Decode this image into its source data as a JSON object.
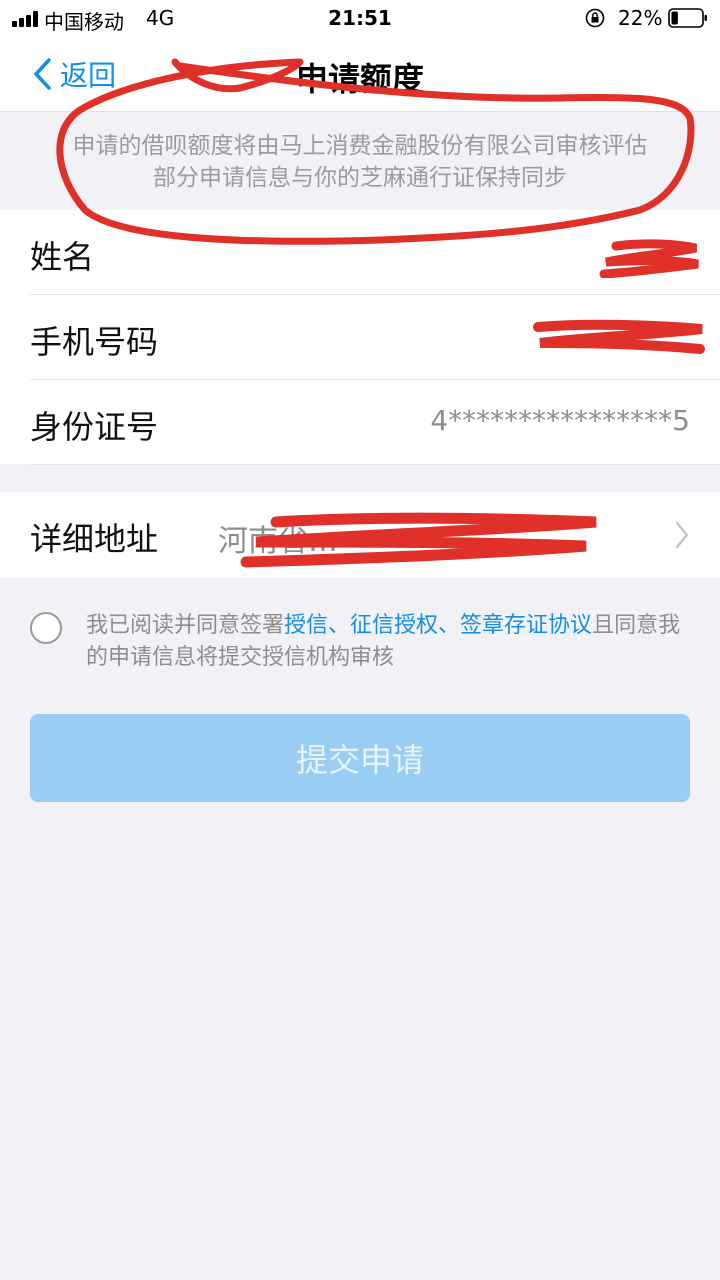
{
  "status_bar": {
    "carrier": "中国移动",
    "network": "4G",
    "time": "21:51",
    "battery_percent": "22%",
    "battery_level": 0.22
  },
  "nav": {
    "back_label": "返回",
    "title": "申请额度"
  },
  "notice": {
    "line1": "申请的借呗额度将由马上消费金融股份有限公司审核评估",
    "line2": "部分申请信息与你的芝麻通行证保持同步"
  },
  "form": {
    "name_label": "姓名",
    "phone_label": "手机号码",
    "id_label": "身份证号",
    "id_value": "4****************5",
    "address_label": "详细地址",
    "address_value": "河南省…"
  },
  "agreement": {
    "prefix": "我已阅读并同意签署",
    "links": [
      "授信、",
      "征信授权、",
      "签章存证协议"
    ],
    "suffix": "且同意我的申请信息将提交授信机构审核",
    "checked": false
  },
  "submit": {
    "label": "提交申请",
    "enabled": false
  },
  "colors": {
    "accent": "#108ee9",
    "button_disabled": "#99cdf4",
    "background": "#f2f2f6",
    "redaction": "#e0302a"
  },
  "icons": {
    "back": "chevron-left-icon",
    "row_arrow": "chevron-right-icon",
    "signal": "signal-bars-icon",
    "lock": "orientation-lock-icon",
    "battery": "battery-icon"
  }
}
